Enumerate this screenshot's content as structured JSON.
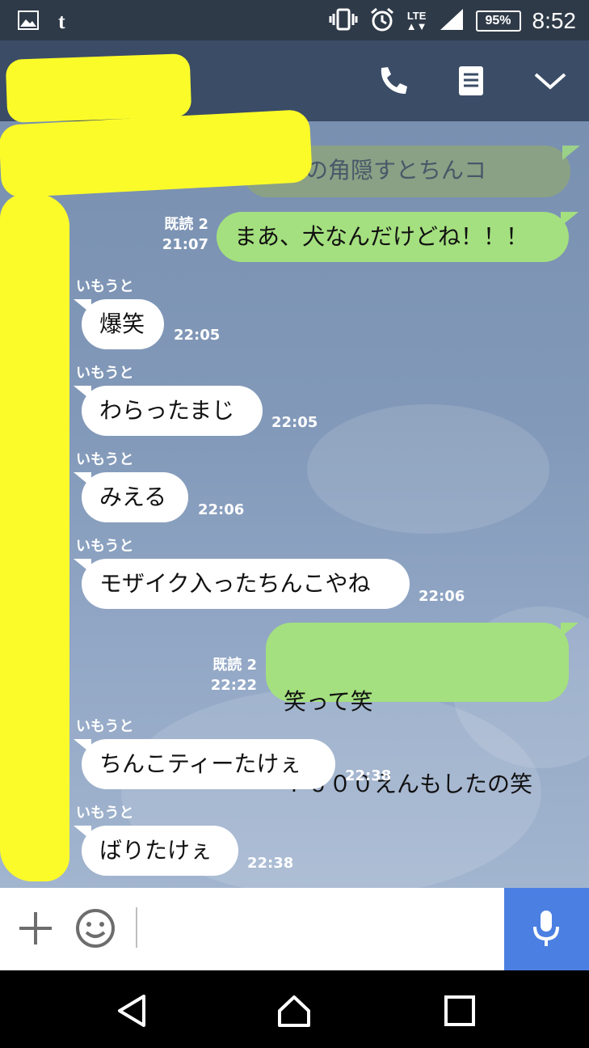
{
  "status_bar": {
    "time": "8:52",
    "battery": "95%",
    "network": "LTE",
    "icons": [
      "gallery-icon",
      "tumblr-icon",
      "vibrate-icon",
      "alarm-icon",
      "signal-icon",
      "battery-icon"
    ]
  },
  "header": {
    "icons": [
      "phone-icon",
      "notes-icon",
      "chevron-down-icon"
    ]
  },
  "messages": {
    "partial": {
      "text": "に耳の角隠すとちんコ"
    },
    "m1": {
      "text": "まあ、犬なんだけどね！！！",
      "read": "既読 2",
      "time": "21:07"
    },
    "m2": {
      "sender": "いもうと",
      "text": "爆笑",
      "time": "22:05"
    },
    "m3": {
      "sender": "いもうと",
      "text": "わらったまじ",
      "time": "22:05"
    },
    "m4": {
      "sender": "いもうと",
      "text": "みえる",
      "time": "22:06"
    },
    "m5": {
      "sender": "いもうと",
      "text": "モザイク入ったちんこやね",
      "time": "22:06"
    },
    "m6": {
      "line1": "笑って笑",
      "line2": "７６００えんもしたの笑",
      "read": "既読 2",
      "time": "22:22"
    },
    "m7": {
      "sender": "いもうと",
      "text": "ちんこティーたけぇ",
      "time": "22:38"
    },
    "m8": {
      "sender": "いもうと",
      "text": "ばりたけぇ",
      "time": "22:38"
    }
  },
  "input_bar": {
    "placeholder": "",
    "icons": [
      "plus-icon",
      "emoji-icon",
      "microphone-icon"
    ]
  },
  "nav_bar": {
    "icons": [
      "back-icon",
      "home-icon",
      "recents-icon"
    ]
  },
  "colors": {
    "outgoing_bubble": "#a4e07f",
    "incoming_bubble": "#ffffff",
    "header": "#3a4c66",
    "mic_button": "#4b7fe2",
    "redaction": "#fbfb2a"
  }
}
